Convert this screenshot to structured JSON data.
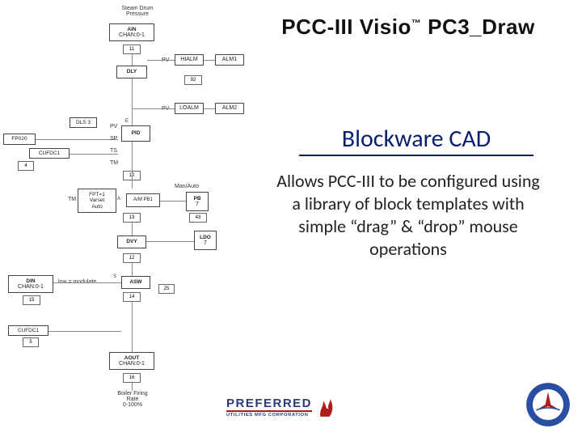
{
  "title": {
    "pre": "PCC-III Visio",
    "tm": "™",
    "post": " PC3_Draw"
  },
  "subtitle": "Blockware CAD",
  "body": "Allows PCC-III to be configured using a library of block templates with simple “drag” & “drop” mouse operations",
  "diagram": {
    "top_label": "Steam Drum\nPressure",
    "blocks": {
      "ain": {
        "hdr": "AIN",
        "sub": "CHAN:0-1"
      },
      "b11": "11",
      "dly": {
        "hdr": "DLY"
      },
      "hialm": "HIALM",
      "alm1": "ALM1",
      "b92": "92",
      "loalm": "LOALM",
      "alm2": "ALM2",
      "dls3": "DLS 3",
      "fp020": "FP020",
      "d4": "4",
      "cufdc1a": "CUFDC1",
      "pv": "PV",
      "sp": "SP",
      "ts": "TS",
      "tm": "TM",
      "pid": {
        "hdr": "PID"
      },
      "b10": "10",
      "fptr1": "FPT=1\nVarset\nAuto",
      "am_pb1": "A/M PB1",
      "b13": "13",
      "manauto": "Man/Auto",
      "pb": {
        "hdr": "PB",
        "num": "7"
      },
      "b43": "43",
      "dvy2": {
        "hdr": "DVY"
      },
      "ldo": {
        "hdr": "LDO",
        "num": "7"
      },
      "b12": "12",
      "din": {
        "hdr": "DIN",
        "sub": "CHAN:0-1"
      },
      "b15": "15",
      "lowmod": "low = modulate",
      "asw": {
        "hdr": "ASW"
      },
      "b14": "14",
      "d25": "25",
      "cufdc1b": "CUFDC1",
      "b5": "5",
      "aout": {
        "hdr": "AOUT",
        "sub": "CHAN:0-1"
      },
      "d16": "16",
      "bottom_label": "Boiler Firing\nRate\n0-100%"
    }
  },
  "footer": {
    "brand": "PREFERRED",
    "brand_sub": "UTILITIES MFG CORPORATION"
  }
}
